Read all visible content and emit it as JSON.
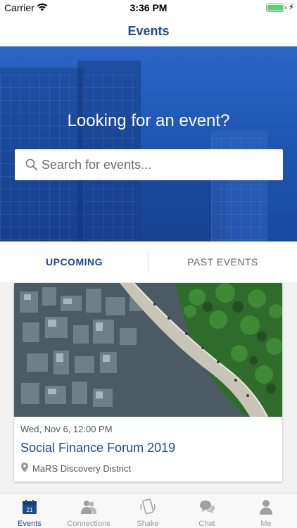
{
  "status_bar": {
    "carrier": "Carrier",
    "time": "3:36 PM"
  },
  "nav": {
    "title": "Events"
  },
  "hero": {
    "headline": "Looking for an event?",
    "search_placeholder": "Search for events..."
  },
  "tabs": [
    {
      "label": "UPCOMING",
      "active": true
    },
    {
      "label": "PAST EVENTS",
      "active": false
    }
  ],
  "event": {
    "date": "Wed, Nov 6, 12:00 PM",
    "title": "Social Finance Forum 2019",
    "location": "MaRS Discovery District"
  },
  "tab_bar": {
    "items": [
      {
        "label": "Events",
        "icon": "calendar-icon",
        "badge": "21",
        "active": true
      },
      {
        "label": "Connections",
        "icon": "people-icon",
        "active": false
      },
      {
        "label": "Shake",
        "icon": "phone-shake-icon",
        "active": false
      },
      {
        "label": "Chat",
        "icon": "chat-bubbles-icon",
        "active": false
      },
      {
        "label": "Me",
        "icon": "person-icon",
        "active": false
      }
    ]
  },
  "colors": {
    "brand": "#1e4a8f",
    "hero": "#2360c0",
    "battery": "#4cd964",
    "inactive": "#9a9a9a"
  }
}
